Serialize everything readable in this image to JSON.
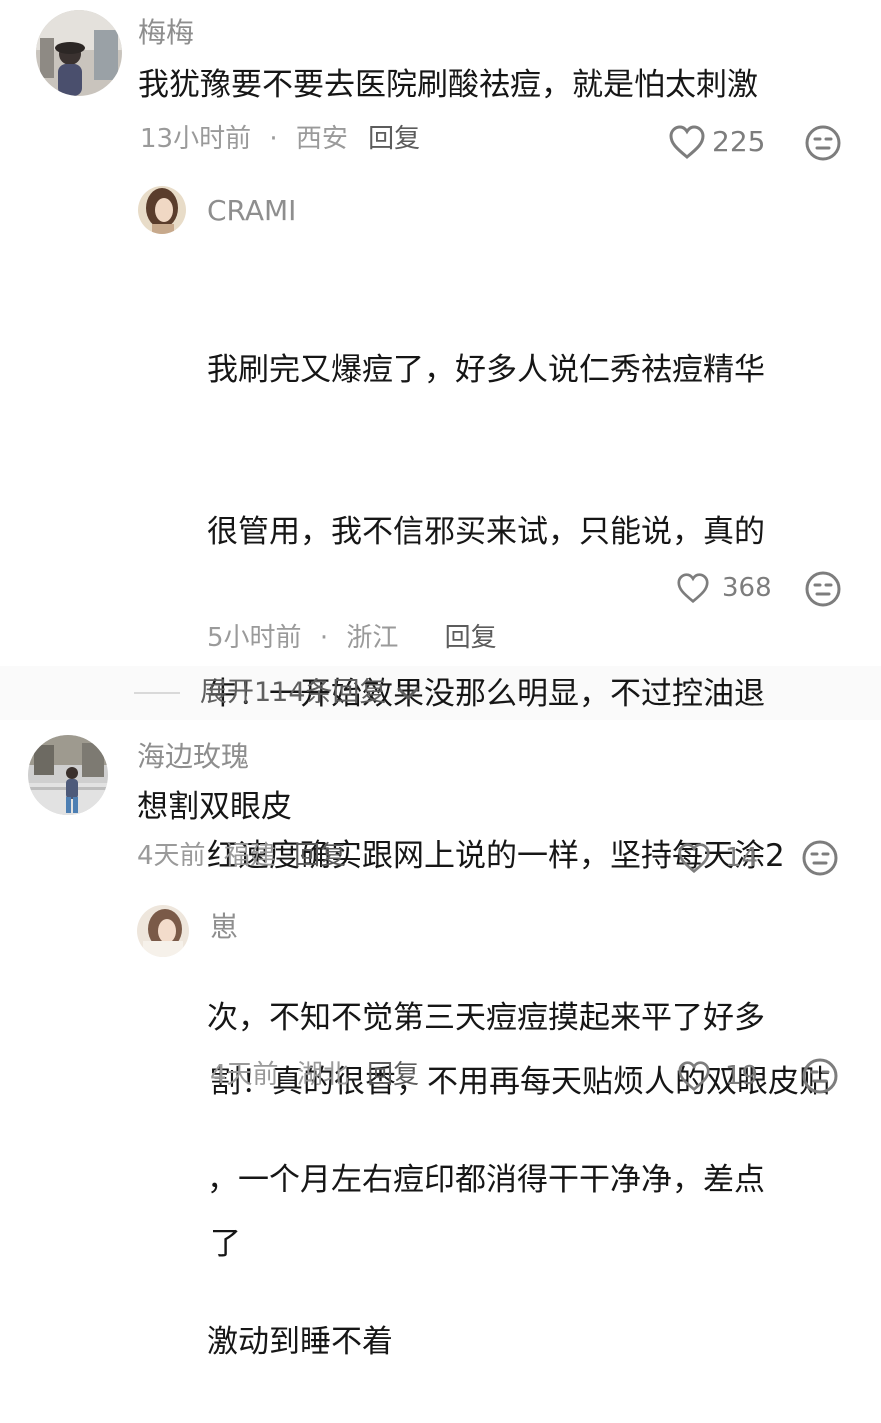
{
  "comments": [
    {
      "user": "梅梅",
      "text": "我犹豫要不要去医院刷酸祛痘，就是怕太刺激",
      "time": "13小时前",
      "location": "西安",
      "reply_label": "回复",
      "likes": "225",
      "replies": [
        {
          "user": "CRAMI",
          "lines": [
            "我刷完又爆痘了，好多人说仁秀祛痘精华",
            "很管用，我不信邪买来试，只能说，真的",
            "牛！一开始效果没那么明显，不过控油退",
            "红速度确实跟网上说的一样，坚持每天涂2",
            "次，不知不觉第三天痘痘摸起来平了好多",
            "，一个月左右痘印都消得干干净净，差点",
            "激动到睡不着"
          ],
          "time": "5小时前",
          "location": "浙江",
          "reply_label": "回复",
          "likes": "368"
        }
      ],
      "expand_label": "展开114条回复"
    },
    {
      "user": "海边玫瑰",
      "text": "想割双眼皮",
      "time": "4天前",
      "location": "福建",
      "reply_label": "回复",
      "likes": "14",
      "replies": [
        {
          "user": "崽",
          "lines": [
            "割！真的很香，不用再每天贴烦人的双眼皮贴",
            "了"
          ],
          "time": "4天前",
          "location": "湖北",
          "reply_label": "回复",
          "likes": "19"
        }
      ]
    }
  ],
  "meta_separator": "·",
  "icons": {
    "like": "heart-outline-icon",
    "dislike": "neutral-face-icon",
    "expand": "chevron-down-icon"
  },
  "colors": {
    "text": "#161616",
    "username": "#8e8e8e",
    "meta": "#9a9a9a",
    "icon": "#7d7d7d"
  }
}
